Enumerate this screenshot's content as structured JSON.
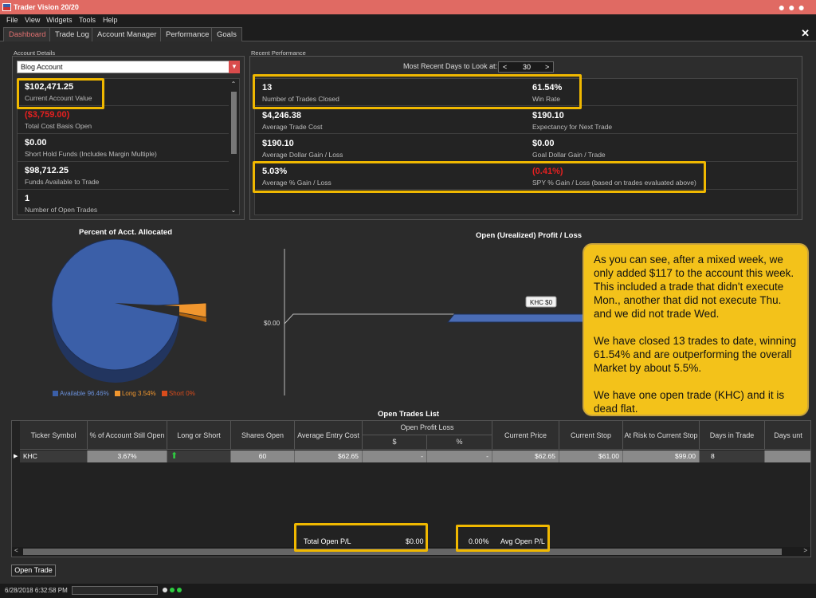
{
  "window": {
    "title": "Trader Vision 20/20"
  },
  "menu": [
    "File",
    "View",
    "Widgets",
    "Tools",
    "Help"
  ],
  "tabs": [
    "Dashboard",
    "Trade Log",
    "Account Manager",
    "Performance",
    "Goals"
  ],
  "account_details": {
    "label": "Account Details",
    "selected_account": "Blog Account",
    "items": [
      {
        "value": "$102,471.25",
        "label": "Current Account Value"
      },
      {
        "value": "($3,759.00)",
        "label": "Total Cost Basis Open"
      },
      {
        "value": "$0.00",
        "label": "Short Hold Funds (Includes Margin Multiple)"
      },
      {
        "value": "$98,712.25",
        "label": "Funds Available to Trade"
      },
      {
        "value": "1",
        "label": "Number of Open Trades"
      }
    ]
  },
  "recent_performance": {
    "label": "Recent Performance",
    "days_label": "Most Recent Days to Look at:",
    "days_value": "30",
    "rows": [
      {
        "left_value": "13",
        "left_label": "Number of Trades Closed",
        "right_value": "61.54%",
        "right_label": "Win Rate"
      },
      {
        "left_value": "$4,246.38",
        "left_label": "Average Trade Cost",
        "right_value": "$190.10",
        "right_label": "Expectancy for Next Trade"
      },
      {
        "left_value": "$190.10",
        "left_label": "Average Dollar Gain / Loss",
        "right_value": "$0.00",
        "right_label": "Goal Dollar Gain / Trade"
      },
      {
        "left_value": "5.03%",
        "left_label": "Average % Gain / Loss",
        "right_value": "(0.41%)",
        "right_label": "SPY % Gain / Loss (based on trades evaluated above)"
      }
    ]
  },
  "pie": {
    "title": "Percent of Acct. Allocated",
    "legend": [
      {
        "name": "Available",
        "value": "96.46%",
        "color": "#3b5fa8"
      },
      {
        "name": "Long",
        "value": "3.54%",
        "color": "#f0962e"
      },
      {
        "name": "Short",
        "value": "0%",
        "color": "#d94c1c"
      }
    ]
  },
  "pl_chart": {
    "title": "Open (Urealized) Profit / Loss",
    "y_tick": "$0.00",
    "bar_label": "KHC $0"
  },
  "chart_data": [
    {
      "type": "pie",
      "title": "Percent of Acct. Allocated",
      "categories": [
        "Available",
        "Long",
        "Short"
      ],
      "values": [
        96.46,
        3.54,
        0
      ]
    },
    {
      "type": "bar",
      "title": "Open (Urealized) Profit / Loss",
      "categories": [
        "KHC"
      ],
      "values": [
        0
      ],
      "ylabel": ""
    }
  ],
  "callout": {
    "p1": "As you can see, after a mixed week, we only added $117 to the account this week.  This included a trade that didn't execute Mon., another that did not execute Thu. and we did not trade Wed.",
    "p2": "We have closed 13 trades to date, winning 61.54% and are outperforming the overall Market by about 5.5%.",
    "p3": "We have one open trade (KHC) and it is dead flat."
  },
  "open_trades": {
    "title": "Open Trades List",
    "headers": [
      "Ticker Symbol",
      "% of Account Still Open",
      "Long or Short",
      "Shares Open",
      "Average Entry Cost",
      "Open Profit Loss",
      "$",
      "%",
      "Current Price",
      "Current Stop",
      "At Risk to Current Stop",
      "Days in Trade",
      "Days unt"
    ],
    "row": {
      "ticker": "KHC",
      "pct_open": "3.67%",
      "shares": "60",
      "entry": "$62.65",
      "pl_dollar": "-",
      "pl_pct": "-",
      "price": "$62.65",
      "stop": "$61.00",
      "risk": "$99.00",
      "days": "8"
    },
    "total_label": "Total Open P/L",
    "total_value": "$0.00",
    "avg_value": "0.00%",
    "avg_label": "Avg Open P/L"
  },
  "buttons": {
    "open_trade": "Open Trade"
  },
  "status": {
    "timestamp": "6/28/2018 6:32:58 PM"
  }
}
